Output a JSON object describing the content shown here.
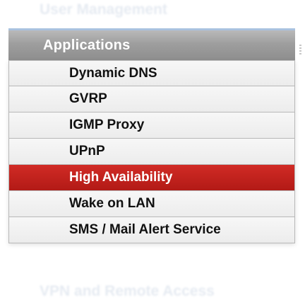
{
  "ghost_top": "User Management",
  "ghost_bottom": "VPN and Remote Access",
  "menu": {
    "header": "Applications",
    "items": [
      {
        "label": "Dynamic DNS",
        "active": false
      },
      {
        "label": "GVRP",
        "active": false
      },
      {
        "label": "IGMP Proxy",
        "active": false
      },
      {
        "label": "UPnP",
        "active": false
      },
      {
        "label": "High Availability",
        "active": true
      },
      {
        "label": "Wake on LAN",
        "active": false
      },
      {
        "label": "SMS / Mail Alert Service",
        "active": false
      }
    ]
  },
  "colors": {
    "active_bg": "#c4221d",
    "header_bg": "#9e9e9e",
    "item_bg": "#efefef"
  }
}
